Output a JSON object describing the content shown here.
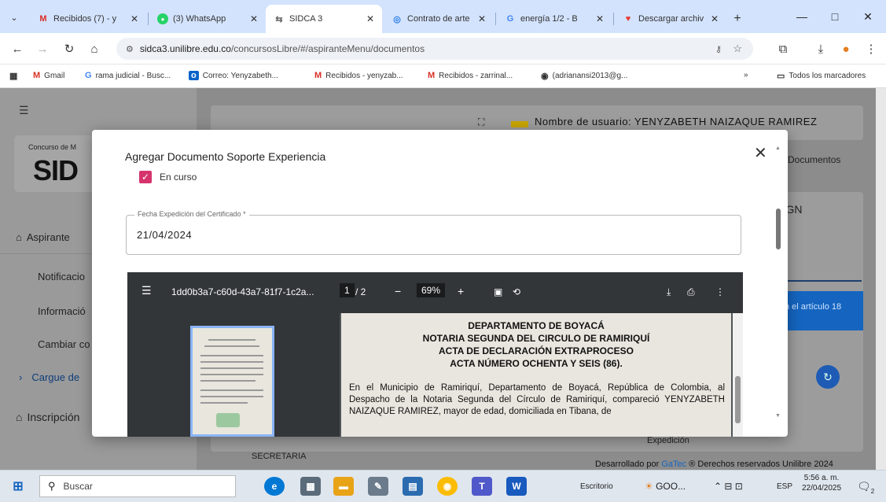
{
  "browser": {
    "tabs": [
      {
        "label": "Recibidos (7) - y",
        "icon": "gmail-icon"
      },
      {
        "label": "(3) WhatsApp",
        "icon": "whatsapp-icon"
      },
      {
        "label": "SIDCA 3",
        "icon": "sidca-icon"
      },
      {
        "label": "Contrato de arte",
        "icon": "copilot-icon"
      },
      {
        "label": "energía 1/2 - B",
        "icon": "google-icon"
      },
      {
        "label": "Descargar archiv",
        "icon": "download-site-icon"
      }
    ],
    "new_tab": "+",
    "window_buttons": {
      "minimize": "—",
      "maximize": "□",
      "close": "✕"
    },
    "url_domain": "sidca3.unilibre.edu.co",
    "url_path": "/concursosLibre/#/aspiranteMenu/documentos",
    "bookmarks": [
      {
        "label": "Gmail",
        "icon": "gmail-icon"
      },
      {
        "label": "rama judicial - Busc...",
        "icon": "google-icon"
      },
      {
        "label": "Correo: Yenyzabeth...",
        "icon": "outlook-icon"
      },
      {
        "label": "Recibidos - yenyzab...",
        "icon": "gmail-icon"
      },
      {
        "label": "Recibidos - zarrinal...",
        "icon": "gmail-icon"
      },
      {
        "label": "(adrianansi2013@g...",
        "icon": "globe-icon"
      }
    ],
    "bookmarks_overflow": "»",
    "all_bookmarks": "Todos los marcadores"
  },
  "app": {
    "logo_caption": "Concurso de M",
    "logo_text": "SID",
    "header_user": "Nombre de usuario: YENYZABETH NAIZAQUE RAMIREZ",
    "breadcrumb_right": "Documentos",
    "card_title_fragment": "s FGN",
    "article_fragment": "n el artículo 18",
    "expedicion": "Expedición",
    "secretaria": "SECRETARIA",
    "footer": {
      "prefix": "Desarrollado por ",
      "brand": "GaTec",
      "suffix": " ® Derechos reservados Unilibre 2024"
    },
    "sidebar": {
      "menu_icon": "☰",
      "aspirante": "Aspirante",
      "items": [
        "Notificacio",
        "Informació",
        "Cambiar co"
      ],
      "cargue": "Cargue de",
      "inscripcion": "Inscripción"
    }
  },
  "modal": {
    "title": "Agregar Documento Soporte Experiencia",
    "close": "✕",
    "checkbox_label": "En curso",
    "checkbox_checked": true,
    "field_label": "Fecha Expedición del Certificado *",
    "field_value": "21/04/2024"
  },
  "pdf": {
    "filename": "1dd0b3a7-c60d-43a7-81f7-1c2a...",
    "page_current": "1",
    "page_total": "/ 2",
    "zoom": "69%",
    "doc_heading": [
      "DEPARTAMENTO DE BOYACÁ",
      "NOTARIA SEGUNDA DEL CIRCULO DE RAMIRIQUÍ",
      "ACTA DE DECLARACIÓN EXTRAPROCESO",
      "ACTA NÚMERO OCHENTA Y SEIS (86)."
    ],
    "doc_body": "En el Municipio de Ramiriquí, Departamento de Boyacá, República de Colombia, al Despacho de la Notaria Segunda del Círculo de Ramiriquí, compareció YENYZABETH NAIZAQUE RAMIREZ, mayor de edad, domiciliada en Tibana, de"
  },
  "taskbar": {
    "search": "Buscar",
    "desktop": "Escritorio",
    "goo": "GOO...",
    "lang": "ESP",
    "time": "5:56 a. m.",
    "date": "22/04/2025",
    "notif": "2"
  },
  "colors": {
    "accent": "#d6336c",
    "link": "#1565c0",
    "tabbar": "#d3e3fd",
    "sidebar_blue": "#1e88e5"
  }
}
